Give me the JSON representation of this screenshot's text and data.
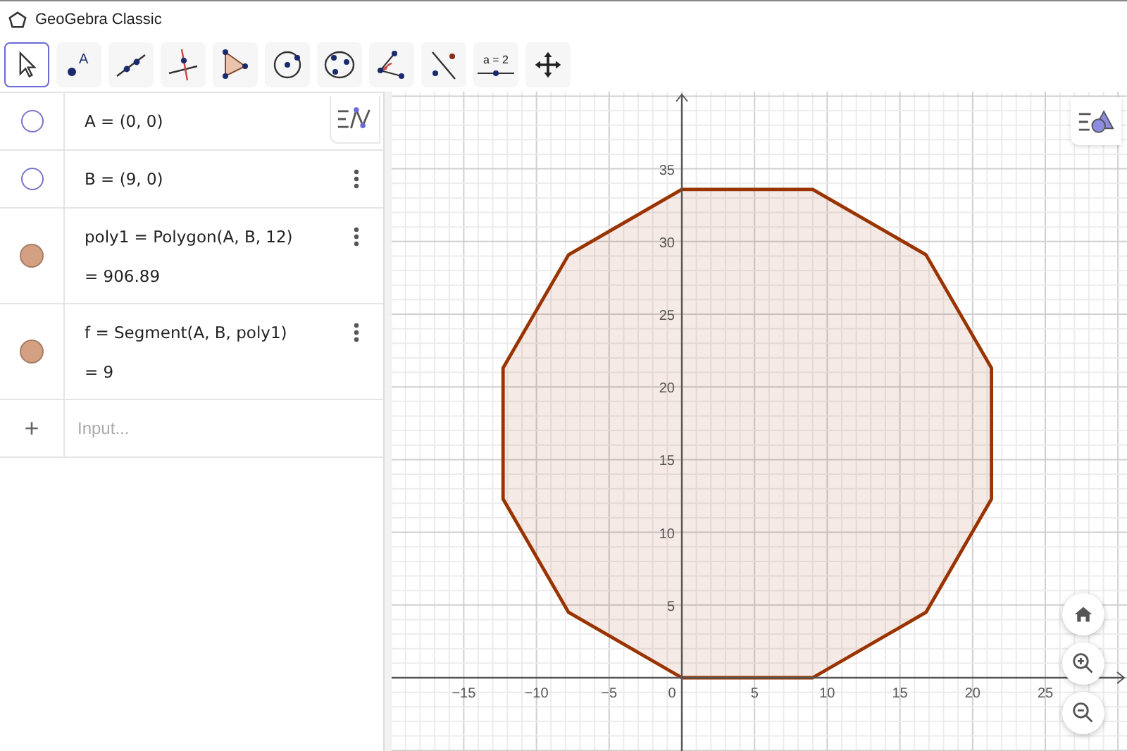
{
  "window": {
    "title": "GeoGebra Classic"
  },
  "toolbar": [
    {
      "kind": "move",
      "selected": true
    },
    {
      "kind": "point",
      "label": "A",
      "selected": false
    },
    {
      "kind": "line",
      "selected": false
    },
    {
      "kind": "perpendicular",
      "selected": false
    },
    {
      "kind": "polygon",
      "selected": false
    },
    {
      "kind": "circle",
      "selected": false
    },
    {
      "kind": "conic",
      "selected": false
    },
    {
      "kind": "angle",
      "selected": false
    },
    {
      "kind": "reflect",
      "selected": false
    },
    {
      "kind": "slider",
      "label": "a = 2",
      "selected": false
    },
    {
      "kind": "pan",
      "selected": false
    }
  ],
  "algebra": {
    "items": [
      {
        "definition": "A = (0, 0)",
        "visible": false,
        "menu": false
      },
      {
        "definition": "B = (9, 0)",
        "visible": false,
        "menu": true
      },
      {
        "definition": "poly1 = Polygon(A, B, 12)",
        "value": "= 906.89",
        "visible": true,
        "menu": true
      },
      {
        "definition": "f = Segment(A, B, poly1)",
        "value": "= 9",
        "visible": true,
        "menu": true
      }
    ],
    "input": {
      "symbol": "+",
      "placeholder": "Input..."
    }
  },
  "graphics": {
    "x_labels": [
      "−15",
      "−10",
      "−5",
      "0",
      "5",
      "10",
      "15",
      "20",
      "25"
    ],
    "y_labels": [
      "35",
      "30",
      "25",
      "20",
      "15",
      "10",
      "5"
    ]
  }
}
